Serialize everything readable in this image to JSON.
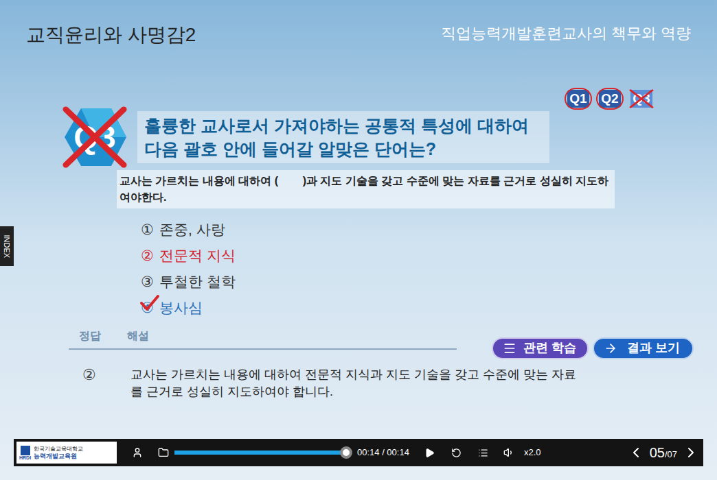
{
  "header": {
    "course_title": "교직윤리와 사명감2",
    "chapter_title": "직업능력개발훈련교사의 책무와 역량"
  },
  "index_tab": "INDEX",
  "question_tracker": [
    {
      "label": "Q1",
      "correct": true,
      "selected": false
    },
    {
      "label": "Q2",
      "correct": true,
      "selected": false
    },
    {
      "label": "Q3",
      "correct": false,
      "selected": true
    }
  ],
  "question": {
    "badge": "Q3",
    "correct": false,
    "title_lines": [
      "훌륭한 교사로서 가져야하는 공통적 특성에 대하여",
      "다음 괄호 안에 들어갈 알맞은 단어는?"
    ],
    "prompt": "교사는 가르치는 내용에 대하여 (        )과 지도 기술을 갖고 수준에 맞는 자료를 근거로 성실히 지도하여야한다."
  },
  "options": [
    {
      "number": "①",
      "text": "존중, 사랑",
      "correct": false,
      "selected": false
    },
    {
      "number": "②",
      "text": "전문적 지식",
      "correct": true,
      "selected": false
    },
    {
      "number": "③",
      "text": "투철한 철학",
      "correct": false,
      "selected": false
    },
    {
      "number": "④",
      "text": "봉사심",
      "correct": false,
      "selected": true
    }
  ],
  "answer": {
    "label": "정답",
    "value": "②"
  },
  "explanation": {
    "label": "해설",
    "text": "교사는 가르치는 내용에 대하여 전문적 지식과 지도 기술을 갖고 수준에 맞는 자료를 근거로 성실히 지도하여야 합니다."
  },
  "buttons": [
    {
      "label": "관련 학습",
      "kind": "related"
    },
    {
      "label": "결과 보기",
      "kind": "result"
    }
  ],
  "player": {
    "logo_mark": "HRDI",
    "logo_lines": [
      "한국기술교육대학교",
      "능력개발교육원"
    ],
    "level": 1,
    "time": "00:14 / 00:14",
    "speed": "x2.0",
    "page_current": "05",
    "page_total": "/07"
  }
}
